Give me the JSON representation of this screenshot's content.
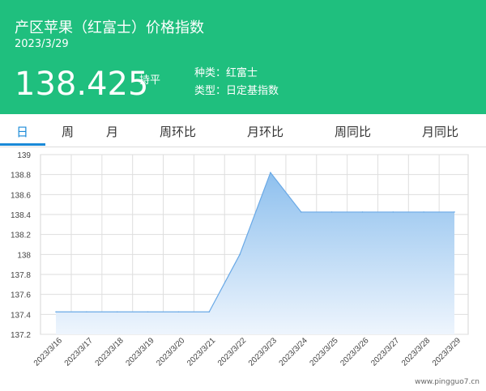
{
  "header": {
    "title": "产区苹果（红富士）价格指数",
    "date": "2023/3/29",
    "price": "138.425",
    "trend": "持平",
    "variety_label": "种类：红富士",
    "type_label": "类型：日定基指数"
  },
  "tabs": [
    {
      "label": "日",
      "active": true
    },
    {
      "label": "周",
      "active": false
    },
    {
      "label": "月",
      "active": false
    },
    {
      "label": "周环比",
      "active": false
    },
    {
      "label": "月环比",
      "active": false
    },
    {
      "label": "周同比",
      "active": false
    },
    {
      "label": "月同比",
      "active": false
    }
  ],
  "watermark": "www.pingguo7.cn",
  "colors": {
    "header_bg": "#1fbf7e",
    "accent": "#1a8ad8",
    "area_top": "#8ec0ee",
    "area_bottom": "#eef5fd",
    "line": "#6aa9e6"
  },
  "chart_data": {
    "type": "area",
    "x": [
      "2023/3/16",
      "2023/3/17",
      "2023/3/18",
      "2023/3/19",
      "2023/3/20",
      "2023/3/21",
      "2023/3/22",
      "2023/3/23",
      "2023/3/24",
      "2023/3/25",
      "2023/3/26",
      "2023/3/27",
      "2023/3/28",
      "2023/3/29"
    ],
    "values": [
      137.425,
      137.425,
      137.425,
      137.425,
      137.425,
      137.425,
      138.0,
      138.82,
      138.425,
      138.425,
      138.425,
      138.425,
      138.425,
      138.425
    ],
    "ylim": [
      137.2,
      139
    ],
    "yticks": [
      "137.2",
      "137.4",
      "137.6",
      "137.8",
      "138",
      "138.2",
      "138.4",
      "138.6",
      "138.8",
      "139"
    ],
    "grid": true
  }
}
